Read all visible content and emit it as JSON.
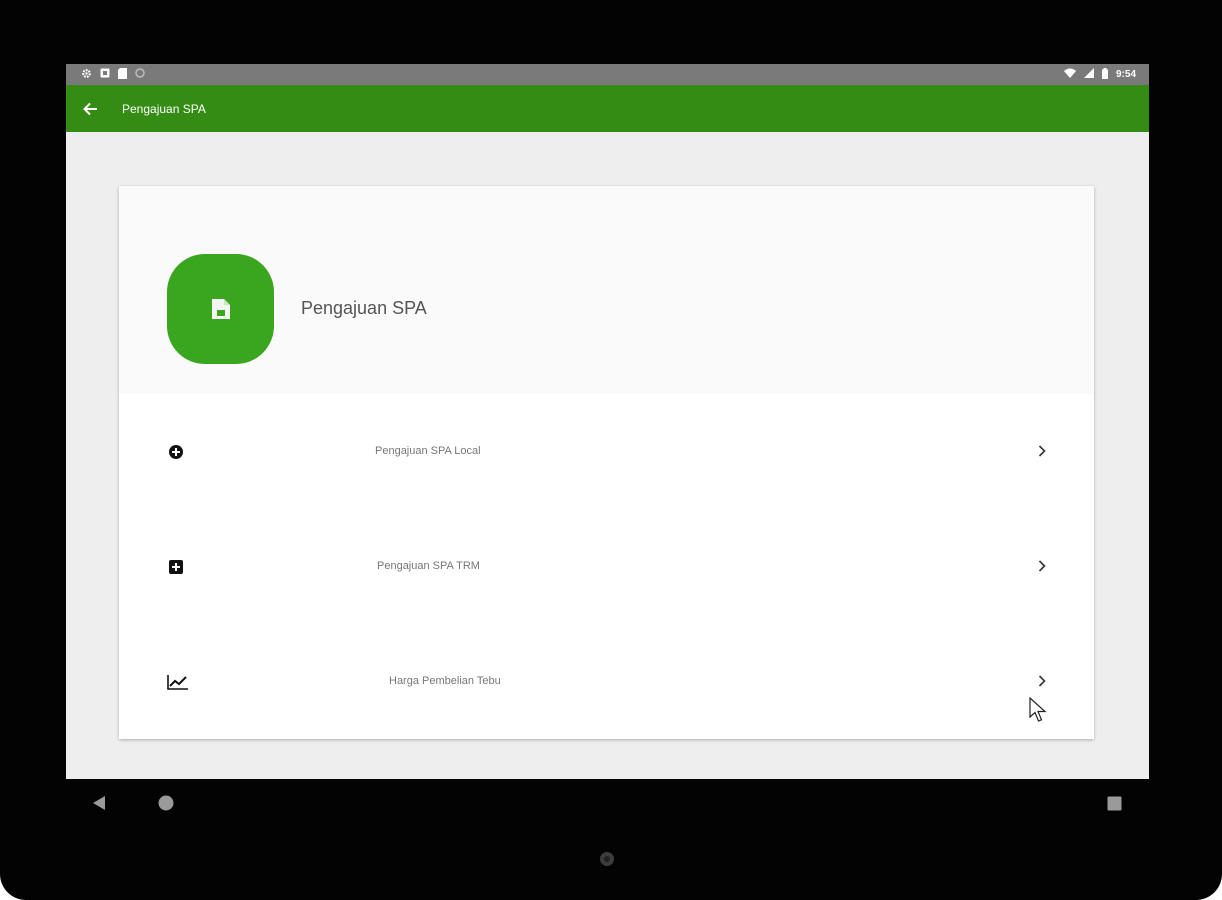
{
  "status_bar": {
    "time": "9:54",
    "icons_left": [
      "settings-icon",
      "notification-icon",
      "sd-card-icon",
      "circle-icon"
    ],
    "icons_right": [
      "wifi-icon",
      "signal-icon",
      "battery-icon"
    ]
  },
  "app_bar": {
    "title": "Pengajuan SPA",
    "color": "#358c14"
  },
  "card": {
    "header_title": "Pengajuan SPA",
    "header_icon": "document-icon",
    "accent": "#3aa51e",
    "items": [
      {
        "label": "Pengajuan SPA Local",
        "icon": "add-circle-icon"
      },
      {
        "label": "Pengajuan SPA TRM",
        "icon": "add-box-icon"
      },
      {
        "label": "Harga Pembelian Tebu",
        "icon": "trending-up-icon"
      }
    ]
  },
  "nav_bar": {
    "buttons": [
      "back-nav-icon",
      "home-nav-icon",
      "recents-nav-icon"
    ]
  }
}
